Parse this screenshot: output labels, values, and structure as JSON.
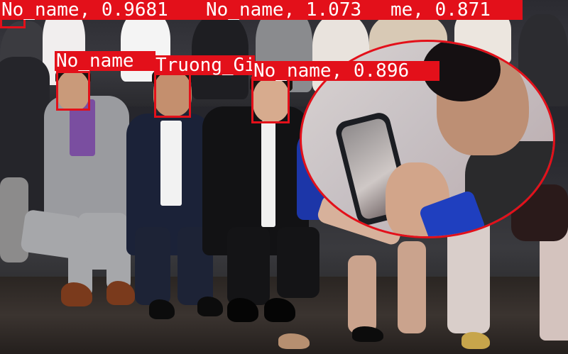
{
  "detections": [
    {
      "label": "No_name, 0.9681"
    },
    {
      "label": "No_name, 1.073"
    },
    {
      "label": "me, 0.871"
    },
    {
      "label": "No_name"
    },
    {
      "label": "Truong_Gi"
    },
    {
      "label": "No_name, 0.896"
    }
  ],
  "colors": {
    "box": "#e3101a",
    "label_text": "#ffffff"
  },
  "icons": {
    "photo": "event-photo"
  }
}
